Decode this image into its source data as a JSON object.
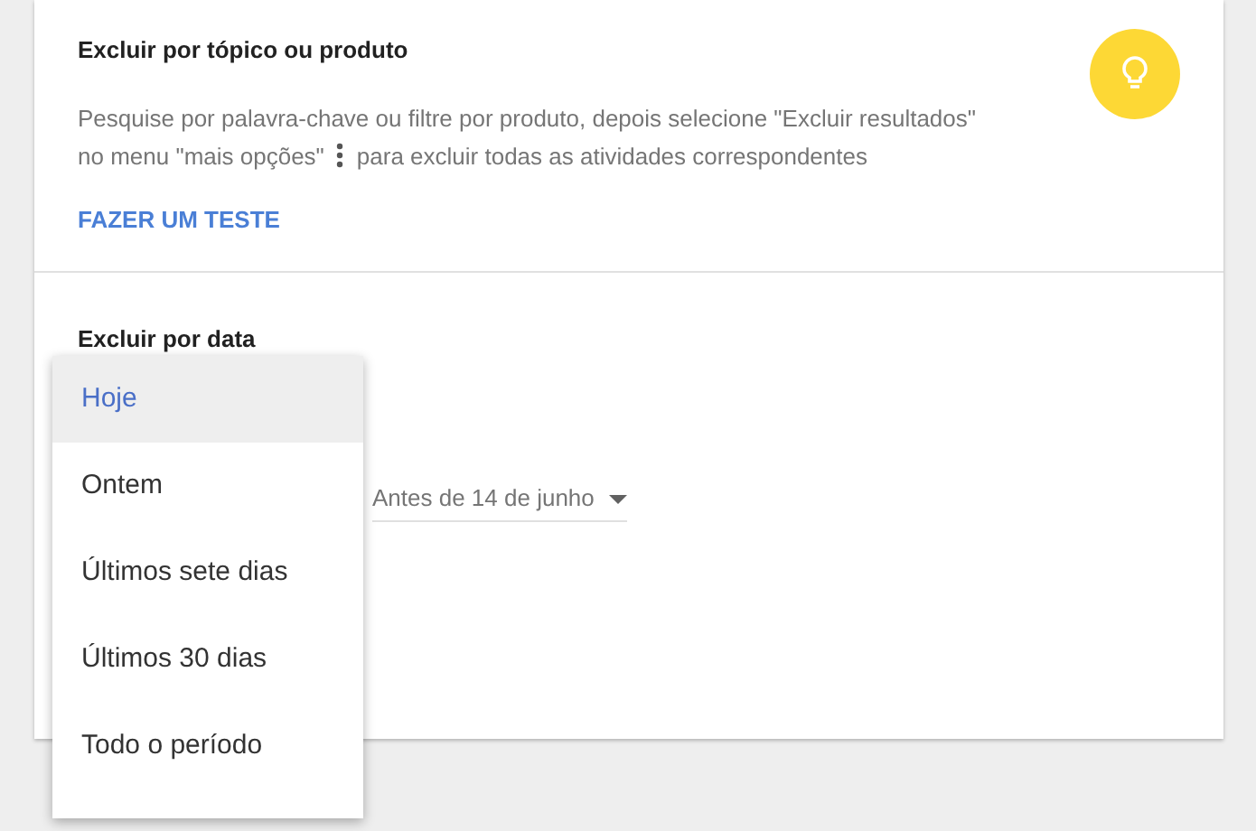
{
  "topic_section": {
    "title": "Excluir por tópico ou produto",
    "description": {
      "line_1": "Pesquise por palavra-chave ou filtre por produto, depois selecione \"Excluir resultados\"",
      "before_icon": "no menu \"mais opções\"",
      "after_icon": "para excluir todas as atividades correspondentes"
    },
    "link": "FAZER UM TESTE"
  },
  "date_section": {
    "title": "Excluir por data",
    "select": {
      "value": "Antes de 14 de junho"
    },
    "menu": [
      {
        "label": "Hoje",
        "selected": true
      },
      {
        "label": "Ontem",
        "selected": false
      },
      {
        "label": "Últimos sete dias",
        "selected": false
      },
      {
        "label": "Últimos 30 dias",
        "selected": false
      },
      {
        "label": "Todo o período",
        "selected": false
      }
    ]
  }
}
